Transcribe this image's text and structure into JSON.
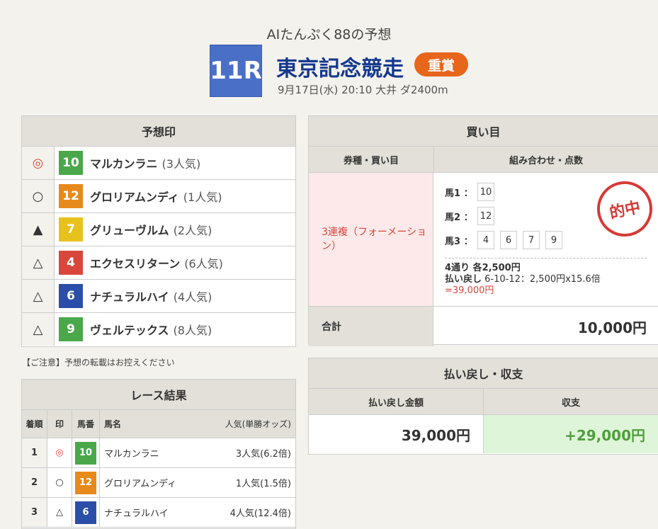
{
  "header": {
    "subtitle": "AIたんぷく88の予想",
    "race_no": "11R",
    "race_name": "東京記念競走",
    "grade": "重賞",
    "info": "9月17日(水) 20:10 大井 ダ2400m"
  },
  "prediction": {
    "title": "予想印",
    "rows": [
      {
        "mark": "◎",
        "num": "10",
        "name": "マルカンラニ",
        "pop": "(3人気)",
        "color": "#4aa84a"
      },
      {
        "mark": "○",
        "num": "12",
        "name": "グロリアムンディ",
        "pop": "(1人気)",
        "color": "#e8891c"
      },
      {
        "mark": "▲",
        "num": "7",
        "name": "グリューヴルム",
        "pop": "(2人気)",
        "color": "#e8c21c"
      },
      {
        "mark": "△",
        "num": "4",
        "name": "エクセスリターン",
        "pop": "(6人気)",
        "color": "#d9463b"
      },
      {
        "mark": "△",
        "num": "6",
        "name": "ナチュラルハイ",
        "pop": "(4人気)",
        "color": "#2b4ea8"
      },
      {
        "mark": "△",
        "num": "9",
        "name": "ヴェルテックス",
        "pop": "(8人気)",
        "color": "#4aa84a"
      }
    ]
  },
  "notice": "【ご注意】予想の転載はお控えください",
  "results": {
    "title": "レース結果",
    "headers": {
      "rank": "着順",
      "mark": "印",
      "num": "馬番",
      "name": "馬名",
      "pop": "人気(単勝オッズ)"
    },
    "rows": [
      {
        "rank": "1",
        "mark": "◎",
        "num": "10",
        "name": "マルカンラニ",
        "pop": "3人気(6.2倍)",
        "color": "#4aa84a"
      },
      {
        "rank": "2",
        "mark": "○",
        "num": "12",
        "name": "グロリアムンディ",
        "pop": "1人気(1.5倍)",
        "color": "#e8891c"
      },
      {
        "rank": "3",
        "mark": "△",
        "num": "6",
        "name": "ナチュラルハイ",
        "pop": "4人気(12.4倍)",
        "color": "#2b4ea8"
      }
    ]
  },
  "bets": {
    "title": "買い目",
    "col1": "券種・買い目",
    "col2": "組み合わせ・点数",
    "type": "3連複（フォーメーション）",
    "horse1_label": "馬1 ：",
    "horse1": [
      "10"
    ],
    "horse2_label": "馬2 ：",
    "horse2": [
      "12"
    ],
    "horse3_label": "馬3 ：",
    "horse3": [
      "4",
      "6",
      "7",
      "9"
    ],
    "points": "4通り 各2,500円",
    "payout_prefix": "払い戻し",
    "payout_detail": "6-10-12：2,500円x15.6倍",
    "payout_result": "=39,000円",
    "stamp": "的中",
    "total_label": "合計",
    "total_value": "10,000円"
  },
  "payout": {
    "title": "払い戻し・収支",
    "col1": "払い戻し金額",
    "col2": "収支",
    "amount": "39,000円",
    "profit": "+29,000円"
  }
}
